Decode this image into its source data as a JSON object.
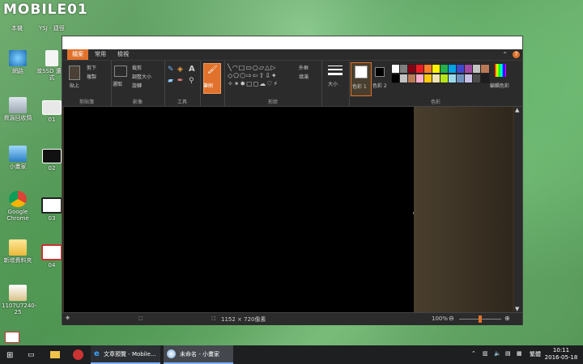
{
  "logo": {
    "text": "MOBILE01"
  },
  "desktop": {
    "top_labels": [
      "本機",
      "YSJ - 捷徑"
    ],
    "icons": [
      {
        "label": "網路"
      },
      {
        "label": "故SSD 還方式"
      },
      {
        "label": "資源回收筒"
      },
      {
        "label": "01"
      },
      {
        "label": "小畫家"
      },
      {
        "label": "02"
      },
      {
        "label": "Google Chrome"
      },
      {
        "label": "03"
      },
      {
        "label": "新增資料夾"
      },
      {
        "label": "04"
      },
      {
        "label": "1107U7240-25"
      }
    ]
  },
  "paint": {
    "tabs": [
      "檔案",
      "常用",
      "檢視"
    ],
    "help": "?",
    "groups": {
      "clipboard": {
        "label": "剪貼簿",
        "paste": "貼上",
        "cut": "剪下",
        "copy": "複製"
      },
      "image": {
        "label": "影像",
        "select": "選取",
        "crop": "裁剪",
        "resize": "調整大小",
        "rotate": "旋轉"
      },
      "tools": {
        "label": "工具"
      },
      "brushes": {
        "label": "筆刷"
      },
      "shapes": {
        "label": "形狀",
        "outline": "外框",
        "fill": "填滿"
      },
      "size": {
        "label": "大小"
      },
      "colors": {
        "label": "色彩",
        "color1": "色彩 1",
        "color2": "色彩 2",
        "edit": "編輯色彩"
      }
    },
    "palette_row1": [
      "#ffffff",
      "#7f7f7f",
      "#880015",
      "#ed1c24",
      "#ff7f27",
      "#fff200",
      "#22b14c",
      "#00a2e8",
      "#3f48cc",
      "#a349a4",
      "#c3c3c3",
      "#b97a57"
    ],
    "palette_row2": [
      "#000000",
      "#c3c3c3",
      "#b97a57",
      "#ffaec9",
      "#ffc90e",
      "#efe4b0",
      "#b5e61d",
      "#99d9ea",
      "#7092be",
      "#c8bfe7",
      "#4b4b4b",
      "#1e1e1e"
    ],
    "status": {
      "dimensions": "1152 × 720像素",
      "zoom": "100%"
    }
  },
  "taskbar": {
    "tasks": [
      {
        "label": "文章預覽 - Mobile..."
      },
      {
        "label": "未命名 - 小畫家"
      }
    ],
    "ime": "繁體",
    "time": "10:11",
    "date": "2016-05-18"
  }
}
